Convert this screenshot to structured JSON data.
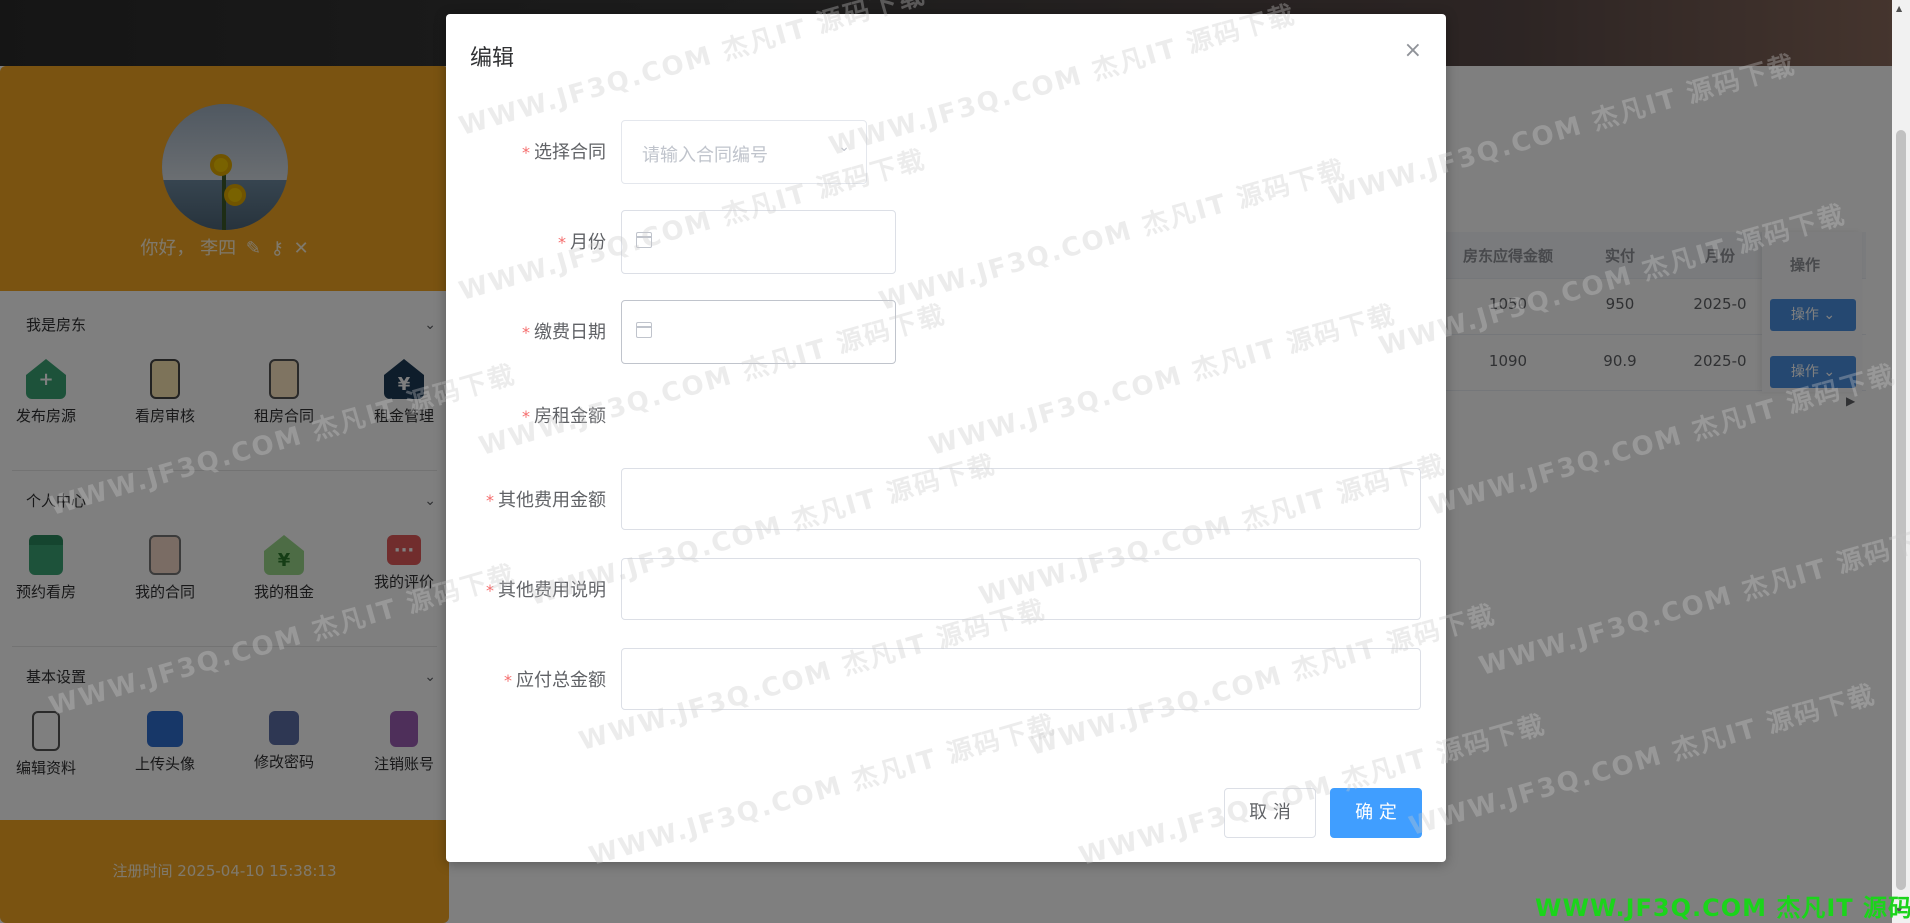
{
  "sidebar": {
    "greeting": "你好， 李四",
    "sections": [
      {
        "title": "我是房东",
        "items": [
          {
            "label": "发布房源",
            "icon": "house-add-icon"
          },
          {
            "label": "看房审核",
            "icon": "review-doc-icon"
          },
          {
            "label": "租房合同",
            "icon": "contract-doc-icon"
          },
          {
            "label": "租金管理",
            "icon": "rent-house-icon"
          }
        ]
      },
      {
        "title": "个人中心",
        "items": [
          {
            "label": "预约看房",
            "icon": "calendar-icon"
          },
          {
            "label": "我的合同",
            "icon": "my-contract-icon"
          },
          {
            "label": "我的租金",
            "icon": "my-rent-icon"
          },
          {
            "label": "我的评价",
            "icon": "chat-bubbles-icon"
          }
        ]
      },
      {
        "title": "基本设置",
        "items": [
          {
            "label": "编辑资料",
            "icon": "edit-doc-icon"
          },
          {
            "label": "上传头像",
            "icon": "user-avatar-icon"
          },
          {
            "label": "修改密码",
            "icon": "lock-icon"
          },
          {
            "label": "注销账号",
            "icon": "logout-door-icon"
          }
        ]
      }
    ],
    "register_time": "注册时间 2025-04-10 15:38:13"
  },
  "table": {
    "headers": [
      "房东应得金额",
      "实付",
      "月份",
      "操作"
    ],
    "rows": [
      {
        "amount": "1050",
        "paid": "950",
        "month": "2025-0"
      },
      {
        "amount": "1090",
        "paid": "90.9",
        "month": "2025-0"
      }
    ],
    "op_label": "操作",
    "op_chevron": "⌄"
  },
  "dialog": {
    "title": "编辑",
    "close": "×",
    "fields": [
      {
        "label": "选择合同",
        "placeholder": "请输入合同编号"
      },
      {
        "label": "月份"
      },
      {
        "label": "缴费日期"
      },
      {
        "label": "房租金额"
      },
      {
        "label": "其他费用金额"
      },
      {
        "label": "其他费用说明"
      },
      {
        "label": "应付总金额"
      }
    ],
    "required_mark": "*",
    "cancel_label": "取 消",
    "confirm_label": "确 定"
  },
  "watermark": {
    "text": "WWW.JF3Q.COM 杰凡IT  源码下载",
    "bottom_text": "WWW.JF3Q.COM 杰凡IT  源码下载"
  },
  "colors": {
    "accent": "#f5a623",
    "primary_button": "#409eff",
    "required": "#f56c6c",
    "watermark_green": "#1bd41b"
  }
}
